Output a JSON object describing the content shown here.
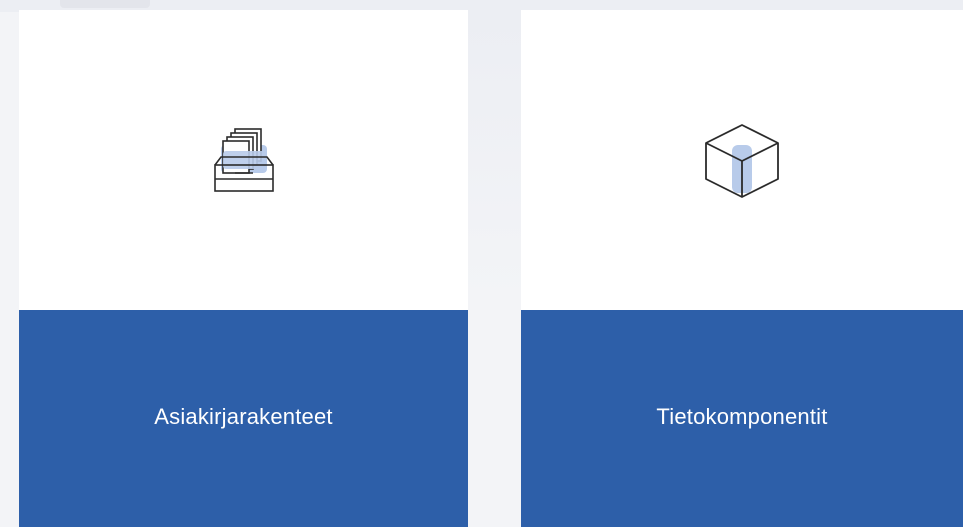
{
  "cards": [
    {
      "label": "Asiakirjarakenteet",
      "icon": "document-drawer-icon"
    },
    {
      "label": "Tietokomponentit",
      "icon": "cube-icon"
    }
  ],
  "colors": {
    "accent": "#2d5fa9",
    "icon_highlight": "#b8cbea",
    "icon_stroke": "#2b2b2b",
    "page_background": "#f3f4f7",
    "card_background": "#ffffff"
  }
}
